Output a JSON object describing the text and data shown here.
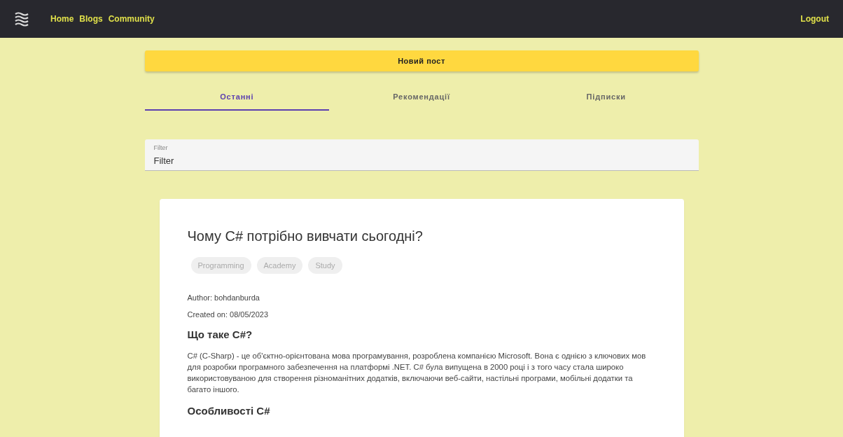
{
  "nav": {
    "links": [
      "Home",
      "Blogs",
      "Community"
    ],
    "logout": "Logout"
  },
  "new_post_button": "Новий пост",
  "tabs": [
    {
      "label": "Останні",
      "selected": true
    },
    {
      "label": "Рекомендації",
      "selected": false
    },
    {
      "label": "Підписки",
      "selected": false
    }
  ],
  "filter": {
    "label": "Filter",
    "value": "Filter"
  },
  "post": {
    "title": "Чому C# потрібно вивчати сьогодні?",
    "tags": [
      "Programming",
      "Academy",
      "Study"
    ],
    "author": "Author: bohdanburda",
    "created": "Created on: 08/05/2023",
    "sections": [
      {
        "heading": "Що таке C#?",
        "text": "C# (C-Sharp) - це об'єктно-орієнтована мова програмування, розроблена компанією Microsoft. Вона є однією з ключових мов для розробки програмного забезпечення на платформі .NET. C# була випущена в 2000 році і з того часу стала широко використовуваною для створення різноманітних додатків, включаючи веб-сайти, настільні програми, мобільні додатки та багато іншого."
      },
      {
        "heading": "Особливості C#"
      }
    ]
  }
}
